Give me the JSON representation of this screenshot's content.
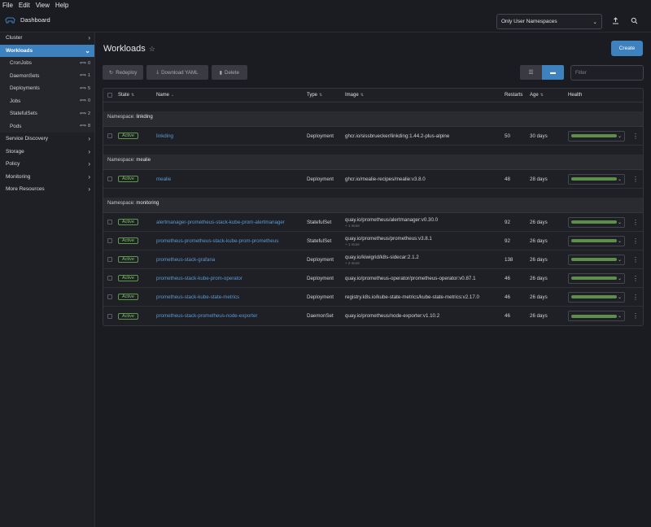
{
  "menubar": {
    "items": [
      "File",
      "Edit",
      "View",
      "Help"
    ]
  },
  "header": {
    "title": "Dashboard",
    "namespace_select": "Only User Namespaces"
  },
  "sidebar": {
    "top": [
      {
        "label": "Cluster"
      }
    ],
    "workloads": {
      "label": "Workloads",
      "children": [
        {
          "label": "CronJobs",
          "count": "0"
        },
        {
          "label": "DaemonSets",
          "count": "1"
        },
        {
          "label": "Deployments",
          "count": "5"
        },
        {
          "label": "Jobs",
          "count": "0"
        },
        {
          "label": "StatefulSets",
          "count": "2"
        },
        {
          "label": "Pods",
          "count": "8"
        }
      ]
    },
    "bottom": [
      {
        "label": "Service Discovery"
      },
      {
        "label": "Storage"
      },
      {
        "label": "Policy"
      },
      {
        "label": "Monitoring"
      },
      {
        "label": "More Resources"
      }
    ]
  },
  "page": {
    "title": "Workloads",
    "create_label": "Create",
    "toolbar": {
      "redeploy": "Redeploy",
      "download": "Download YAML",
      "delete": "Delete"
    },
    "filter_placeholder": "Filter"
  },
  "table": {
    "headers": {
      "state": "State",
      "name": "Name",
      "type": "Type",
      "image": "Image",
      "restarts": "Restarts",
      "age": "Age",
      "health": "Health"
    },
    "groups": [
      {
        "prefix": "Namespace:",
        "namespace": "linkding",
        "rows": [
          {
            "state": "Active",
            "name": "linkding",
            "type": "Deployment",
            "image": "ghcr.io/sissbruecker/linkding:1.44.2-plus-alpine",
            "more": "",
            "restarts": "50",
            "age": "30 days"
          }
        ]
      },
      {
        "prefix": "Namespace:",
        "namespace": "mealie",
        "rows": [
          {
            "state": "Active",
            "name": "mealie",
            "type": "Deployment",
            "image": "ghcr.io/mealie-recipes/mealie:v3.8.0",
            "more": "",
            "restarts": "48",
            "age": "28 days"
          }
        ]
      },
      {
        "prefix": "Namespace:",
        "namespace": "monitoring",
        "rows": [
          {
            "state": "Active",
            "name": "alertmanager-prometheus-stack-kube-prom-alertmanager",
            "type": "StatefulSet",
            "image": "quay.io/prometheus/alertmanager:v0.30.0",
            "more": "+ 1 more",
            "restarts": "92",
            "age": "26 days"
          },
          {
            "state": "Active",
            "name": "prometheus-prometheus-stack-kube-prom-prometheus",
            "type": "StatefulSet",
            "image": "quay.io/prometheus/prometheus:v3.8.1",
            "more": "+ 1 more",
            "restarts": "92",
            "age": "26 days"
          },
          {
            "state": "Active",
            "name": "prometheus-stack-grafana",
            "type": "Deployment",
            "image": "quay.io/kiwigrid/k8s-sidecar:2.1.2",
            "more": "+ 2 more",
            "restarts": "138",
            "age": "26 days"
          },
          {
            "state": "Active",
            "name": "prometheus-stack-kube-prom-operator",
            "type": "Deployment",
            "image": "quay.io/prometheus-operator/prometheus-operator:v0.87.1",
            "more": "",
            "restarts": "46",
            "age": "26 days"
          },
          {
            "state": "Active",
            "name": "prometheus-stack-kube-state-metrics",
            "type": "Deployment",
            "image": "registry.k8s.io/kube-state-metrics/kube-state-metrics:v2.17.0",
            "more": "",
            "restarts": "46",
            "age": "26 days"
          },
          {
            "state": "Active",
            "name": "prometheus-stack-prometheus-node-exporter",
            "type": "DaemonSet",
            "image": "quay.io/prometheus/node-exporter:v1.10.2",
            "more": "",
            "restarts": "46",
            "age": "26 days"
          }
        ]
      }
    ]
  },
  "colors": {
    "accent": "#3d81be",
    "active_green": "#7fc16a",
    "health_bar": "#5e8f4a",
    "link": "#5b9ad4"
  }
}
